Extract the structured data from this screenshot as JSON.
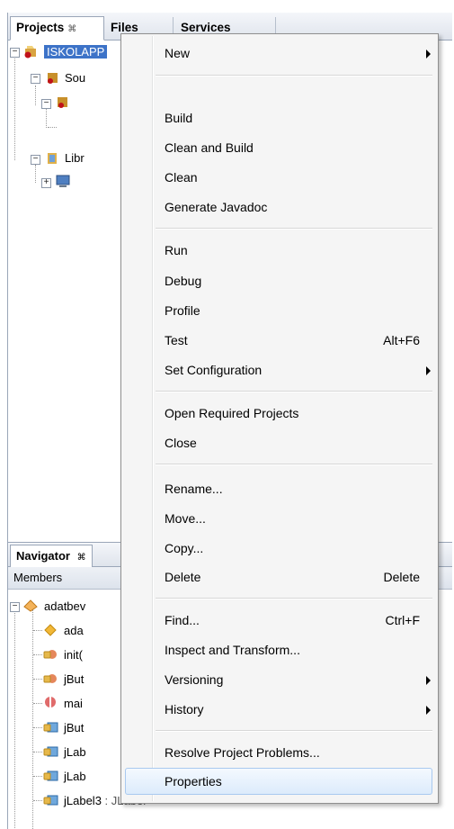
{
  "tabs": [
    {
      "label": "Projects",
      "close": "⌘"
    },
    {
      "label": "Files"
    },
    {
      "label": "Services"
    }
  ],
  "project_tree": {
    "root_label": "ISKOLAPP",
    "source_label": "Sou",
    "libraries_label": "Libr"
  },
  "navigator": {
    "tab_label": "Navigator",
    "tab_close": "⌘",
    "members_label": "Members",
    "items": [
      {
        "label": "adatbev"
      },
      {
        "label": "ada"
      },
      {
        "label": "init("
      },
      {
        "label": "jBut"
      },
      {
        "label": "mai"
      },
      {
        "label": "jBut"
      },
      {
        "label": "jLab"
      },
      {
        "label": "jLab"
      },
      {
        "label": "jLabel3",
        "type": " : JLabel"
      }
    ]
  },
  "context_menu": {
    "items": [
      {
        "label": "New",
        "submenu": true
      },
      {
        "label": "Build"
      },
      {
        "label": "Clean and Build"
      },
      {
        "label": "Clean"
      },
      {
        "label": "Generate Javadoc"
      },
      {
        "label": "Run"
      },
      {
        "label": "Debug"
      },
      {
        "label": "Profile"
      },
      {
        "label": "Test",
        "shortcut": "Alt+F6"
      },
      {
        "label": "Set Configuration",
        "submenu": true
      },
      {
        "label": "Open Required Projects"
      },
      {
        "label": "Close"
      },
      {
        "label": "Rename..."
      },
      {
        "label": "Move..."
      },
      {
        "label": "Copy..."
      },
      {
        "label": "Delete",
        "shortcut": "Delete"
      },
      {
        "label": "Find...",
        "shortcut": "Ctrl+F"
      },
      {
        "label": "Inspect and Transform..."
      },
      {
        "label": "Versioning",
        "submenu": true
      },
      {
        "label": "History",
        "submenu": true
      },
      {
        "label": "Resolve Project Problems..."
      },
      {
        "label": "Properties",
        "highlighted": true
      }
    ]
  }
}
